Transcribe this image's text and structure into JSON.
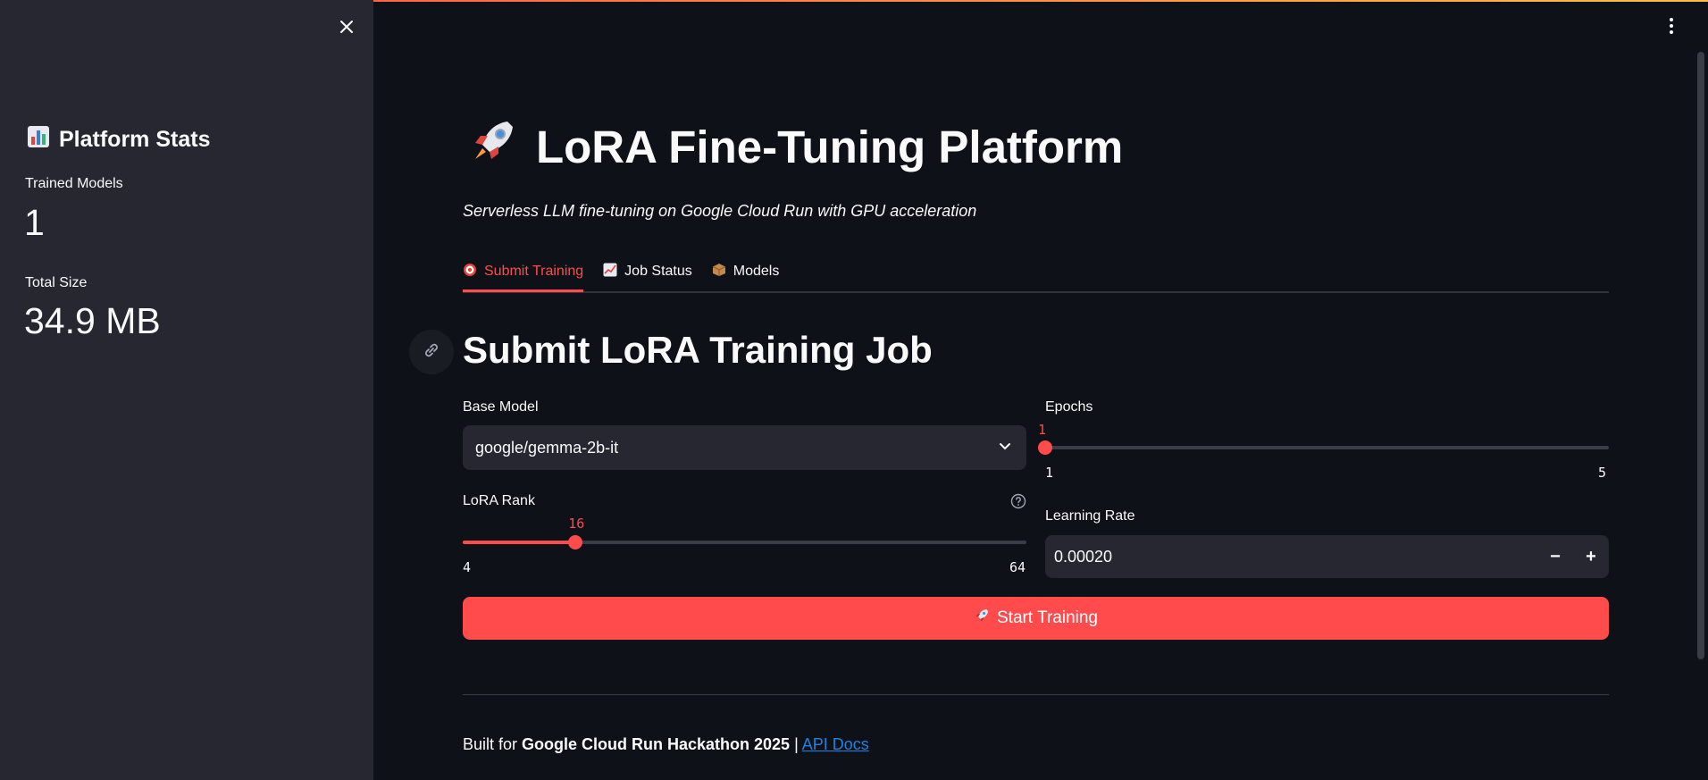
{
  "sidebar": {
    "title": "Platform Stats",
    "title_icon": "bar-chart-icon",
    "stats": [
      {
        "label": "Trained Models",
        "value": "1"
      },
      {
        "label": "Total Size",
        "value": "34.9 MB"
      }
    ]
  },
  "header": {
    "title": "LoRA Fine-Tuning Platform",
    "title_icon": "rocket-icon",
    "subtitle": "Serverless LLM fine-tuning on Google Cloud Run with GPU acceleration"
  },
  "tabs": [
    {
      "label": "Submit Training",
      "icon": "target-icon",
      "active": true
    },
    {
      "label": "Job Status",
      "icon": "chart-increasing-icon",
      "active": false
    },
    {
      "label": "Models",
      "icon": "package-icon",
      "active": false
    }
  ],
  "form": {
    "section_title": "Submit LoRA Training Job",
    "base_model": {
      "label": "Base Model",
      "value": "google/gemma-2b-it"
    },
    "lora_rank": {
      "label": "LoRA Rank",
      "value": 16,
      "value_text": "16",
      "min": 4,
      "max": 64,
      "min_text": "4",
      "max_text": "64"
    },
    "epochs": {
      "label": "Epochs",
      "value": 1,
      "value_text": "1",
      "min": 1,
      "max": 5,
      "min_text": "1",
      "max_text": "5"
    },
    "learning_rate": {
      "label": "Learning Rate",
      "value": "0.00020",
      "decrement": "−",
      "increment": "+"
    },
    "submit_label": "Start Training"
  },
  "footer": {
    "prefix": "Built for ",
    "bold": "Google Cloud Run Hackathon 2025",
    "separator": " | ",
    "link": "API Docs"
  },
  "colors": {
    "accent": "#ff4b4b",
    "background": "#0e1117",
    "sidebar": "#262730",
    "link": "#1c83e1"
  }
}
